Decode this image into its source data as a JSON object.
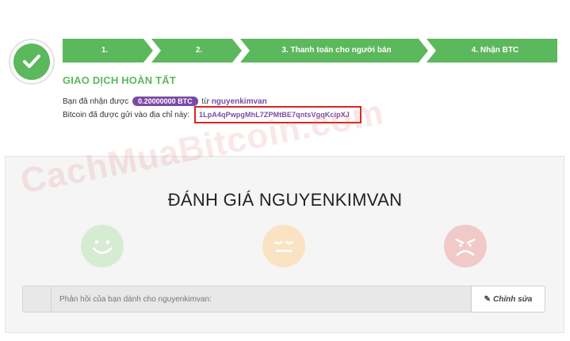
{
  "progress": {
    "steps": [
      {
        "label": "1."
      },
      {
        "label": "2."
      },
      {
        "label": "3. Thanh toán cho người bán"
      },
      {
        "label": "4. Nhận BTC"
      }
    ],
    "color": "#5cb85c"
  },
  "status": {
    "title": "GIAO DỊCH HOÀN TẤT",
    "received_prefix": "Bạn đã nhận được",
    "amount": "0.20000000 BTC",
    "from_word": "từ",
    "seller": "nguyenkimvan",
    "address_prefix": "Bitcoin đã được gửi vào địa chỉ này:",
    "address": "1LpA4qPwpgMhL7ZPMtBE7qntsVgqKcipXJ"
  },
  "watermark": "CachMuaBitcoin.com",
  "review": {
    "title": "ĐÁNH GIÁ NGUYENKIMVAN",
    "ratings": [
      {
        "name": "positive",
        "icon": "smile-face-icon",
        "color": "#d6ecd2"
      },
      {
        "name": "neutral",
        "icon": "neutral-face-icon",
        "color": "#f9e3c4"
      },
      {
        "name": "negative",
        "icon": "angry-face-icon",
        "color": "#f1c9c9"
      }
    ],
    "feedback_placeholder": "Phản hồi của bạn dành cho nguyenkimvan:",
    "edit_label": "Chỉnh sửa",
    "edit_icon": "pencil-icon"
  },
  "colors": {
    "accent_green": "#5cb85c",
    "purple": "#7a4aa6",
    "highlight_red": "#d9261c"
  }
}
